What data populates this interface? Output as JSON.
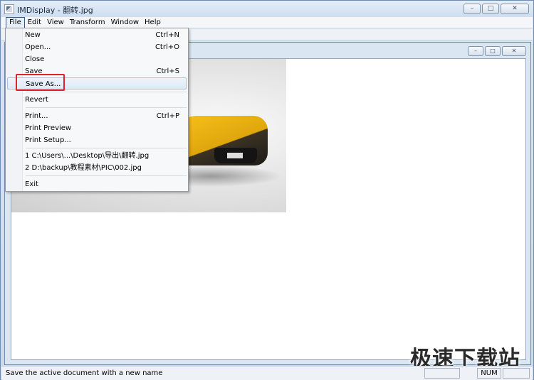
{
  "window": {
    "title": "IMDisplay - 翻转.jpg",
    "minimize_glyph": "–",
    "maximize_glyph": "□",
    "close_glyph": "✕"
  },
  "child": {
    "minimize_glyph": "–",
    "maximize_glyph": "□",
    "close_glyph": "✕"
  },
  "menubar": {
    "items": [
      "File",
      "Edit",
      "View",
      "Transform",
      "Window",
      "Help"
    ],
    "active_index": 0
  },
  "file_menu": {
    "items": [
      {
        "label": "New",
        "shortcut": "Ctrl+N"
      },
      {
        "label": "Open...",
        "shortcut": "Ctrl+O"
      },
      {
        "label": "Close",
        "shortcut": ""
      },
      {
        "label": "Save",
        "shortcut": "Ctrl+S"
      },
      {
        "label": "Save As...",
        "shortcut": "",
        "highlighted": true
      },
      {
        "label": "Revert",
        "shortcut": ""
      },
      {
        "label": "Print...",
        "shortcut": "Ctrl+P"
      },
      {
        "label": "Print Preview",
        "shortcut": ""
      },
      {
        "label": "Print Setup...",
        "shortcut": ""
      },
      {
        "label": "1 C:\\Users\\...\\Desktop\\导出\\翻转.jpg",
        "shortcut": ""
      },
      {
        "label": "2 D:\\backup\\教程素材\\PIC\\002.jpg",
        "shortcut": ""
      },
      {
        "label": "Exit",
        "shortcut": ""
      }
    ]
  },
  "watermark": "极速下载站",
  "statusbar": {
    "message": "Save the active document with a new name",
    "num": "NUM"
  },
  "colors": {
    "highlight_box": "#e0202a",
    "car_yellow": "#f5c21a"
  },
  "icons": {
    "app": "imdisplay-app-icon"
  }
}
